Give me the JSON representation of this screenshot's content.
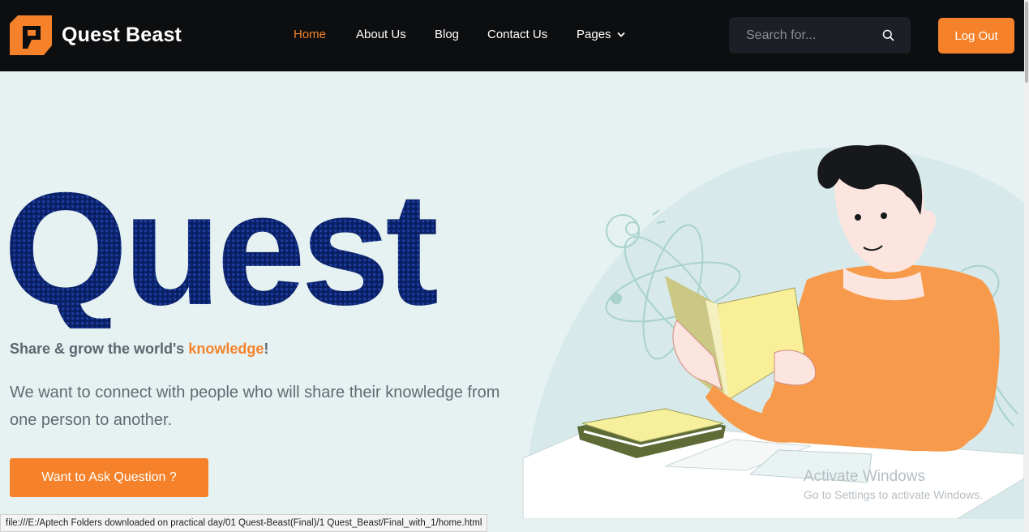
{
  "brand": {
    "name": "Quest Beast",
    "accent": "#f5822a"
  },
  "nav": {
    "items": [
      "Home",
      "About Us",
      "Blog",
      "Contact Us",
      "Pages"
    ],
    "active": "Home"
  },
  "search": {
    "placeholder": "Search for..."
  },
  "logout_label": "Log Out",
  "hero": {
    "headline": "Quest",
    "tagline_prefix": "Share & grow the world's ",
    "tagline_highlight": "knowledge",
    "tagline_suffix": "!",
    "description": "We want to connect with people who will share their knowledge from one person to another.",
    "cta_label": "Want to Ask Question ?"
  },
  "watermark": {
    "line1": "Activate Windows",
    "line2": "Go to Settings to activate Windows."
  },
  "status_url": "file:///E:/Aptech Folders downloaded on practical day/01 Quest-Beast(Final)/1 Quest_Beast/Final_with_1/home.html",
  "icons": [
    "logo-icon",
    "chevron-down-icon",
    "search-icon"
  ]
}
